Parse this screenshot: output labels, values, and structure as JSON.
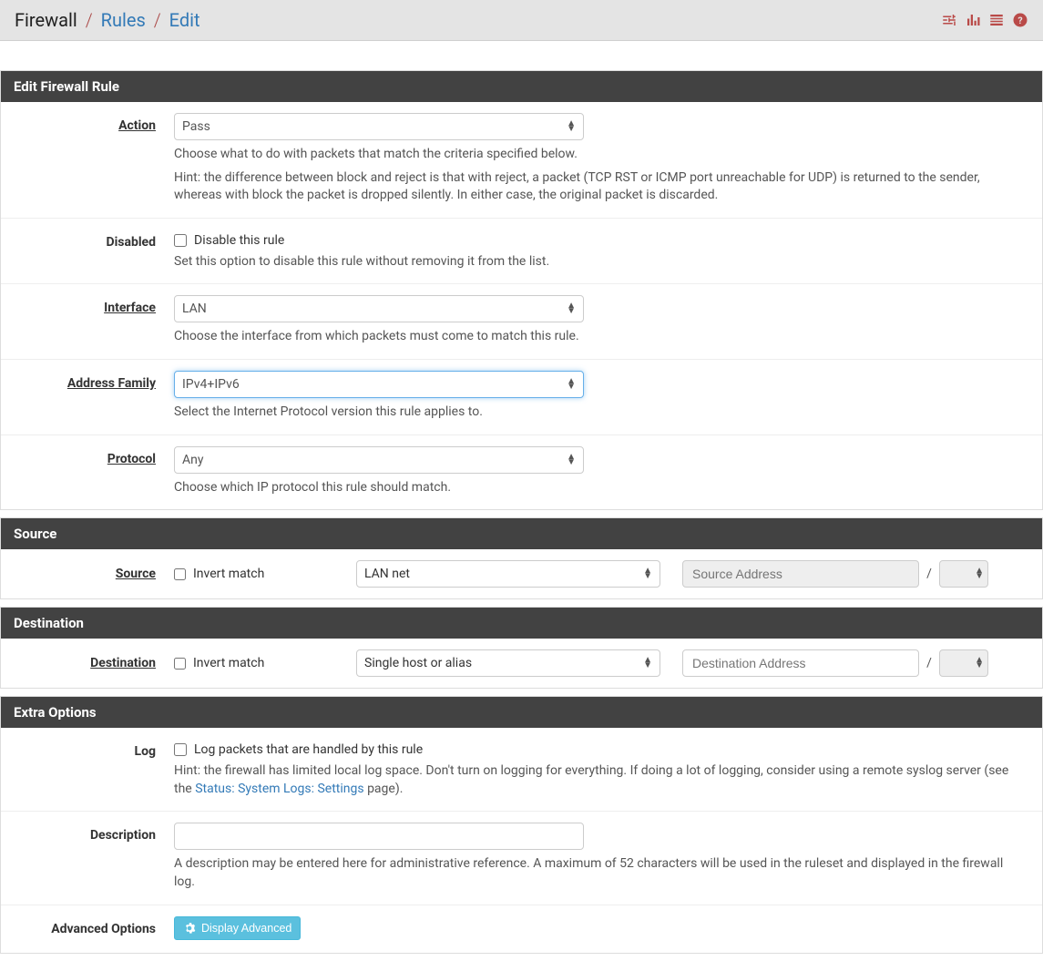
{
  "breadcrumb": {
    "top": "Firewall",
    "mid": "Rules",
    "leaf": "Edit"
  },
  "panels": {
    "edit": {
      "title": "Edit Firewall Rule",
      "action": {
        "label": "Action",
        "value": "Pass",
        "help1": "Choose what to do with packets that match the criteria specified below.",
        "help2": "Hint: the difference between block and reject is that with reject, a packet (TCP RST or ICMP port unreachable for UDP) is returned to the sender, whereas with block the packet is dropped silently. In either case, the original packet is discarded."
      },
      "disabled": {
        "label": "Disabled",
        "checkbox_label": "Disable this rule",
        "checked": false,
        "help": "Set this option to disable this rule without removing it from the list."
      },
      "interface": {
        "label": "Interface",
        "value": "LAN",
        "help": "Choose the interface from which packets must come to match this rule."
      },
      "address_family": {
        "label": "Address Family",
        "value": "IPv4+IPv6",
        "help": "Select the Internet Protocol version this rule applies to."
      },
      "protocol": {
        "label": "Protocol",
        "value": "Any",
        "help": "Choose which IP protocol this rule should match."
      }
    },
    "source": {
      "title": "Source",
      "label": "Source",
      "invert_label": "Invert match",
      "invert_checked": false,
      "type_value": "LAN net",
      "address_placeholder": "Source Address",
      "address_disabled": true,
      "slash": "/"
    },
    "destination": {
      "title": "Destination",
      "label": "Destination",
      "invert_label": "Invert match",
      "invert_checked": false,
      "type_value": "Single host or alias",
      "address_placeholder": "Destination Address",
      "address_disabled": false,
      "slash": "/"
    },
    "extra": {
      "title": "Extra Options",
      "log": {
        "label": "Log",
        "checkbox_label": "Log packets that are handled by this rule",
        "checked": false,
        "help_pre": "Hint: the firewall has limited local log space. Don't turn on logging for everything. If doing a lot of logging, consider using a remote syslog server (see the ",
        "help_link": "Status: System Logs: Settings",
        "help_post": " page)."
      },
      "description": {
        "label": "Description",
        "value": "",
        "help": "A description may be entered here for administrative reference. A maximum of 52 characters will be used in the ruleset and displayed in the firewall log."
      },
      "advanced": {
        "label": "Advanced Options",
        "button": "Display Advanced"
      }
    }
  }
}
